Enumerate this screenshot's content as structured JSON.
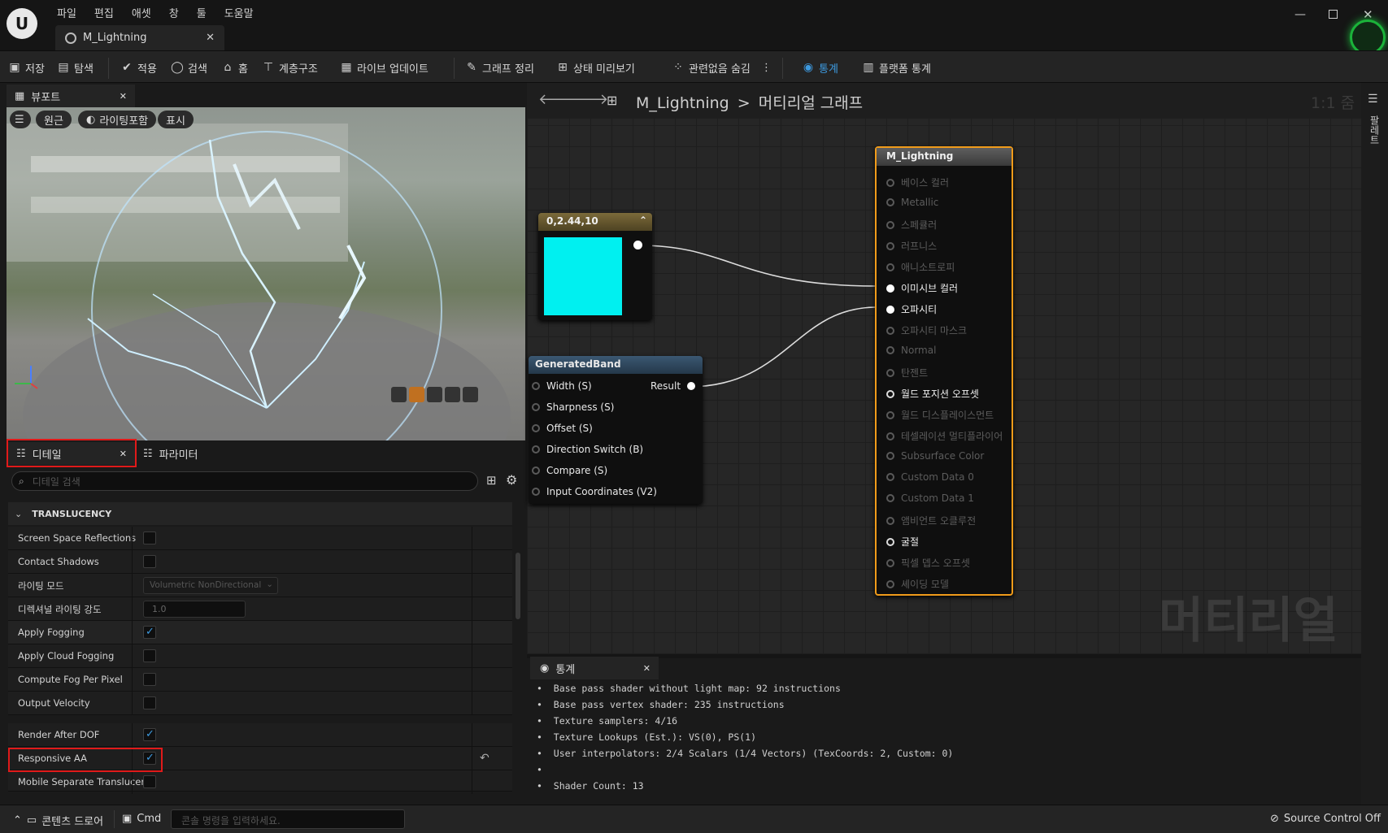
{
  "menu": [
    "파일",
    "편집",
    "애셋",
    "창",
    "툴",
    "도움말"
  ],
  "doc_tab": {
    "title": "M_Lightning"
  },
  "toolbar": {
    "save": "저장",
    "browse": "탐색",
    "apply": "적용",
    "search": "검색",
    "home": "홈",
    "hierarchy": "계층구조",
    "live_update": "라이브 업데이트",
    "clean_graph": "그래프 정리",
    "preview_state": "상태 미리보기",
    "hide_unrelated": "관련없음 숨김",
    "stats": "통계",
    "platform_stats": "플랫폼 통계"
  },
  "viewport": {
    "tab": "뷰포트",
    "perspective": "원근",
    "lit": "라이팅포함",
    "show": "표시"
  },
  "details": {
    "tab": "디테일",
    "params_tab": "파라미터",
    "search_placeholder": "디테일 검색",
    "section": "TRANSLUCENCY",
    "rows": [
      {
        "label": "Screen Space Reflections",
        "checked": false
      },
      {
        "label": "Contact Shadows",
        "checked": false
      },
      {
        "label": "라이팅 모드",
        "value": "Volumetric NonDirectional"
      },
      {
        "label": "디렉셔널 라이팅 강도",
        "value": "1.0"
      },
      {
        "label": "Apply Fogging",
        "checked": true
      },
      {
        "label": "Apply Cloud Fogging",
        "checked": false
      },
      {
        "label": "Compute Fog Per Pixel",
        "checked": false
      },
      {
        "label": "Output Velocity",
        "checked": false
      },
      {
        "label": "Render After DOF",
        "checked": true
      },
      {
        "label": "Responsive AA",
        "checked": true
      },
      {
        "label": "Mobile Separate Translucer",
        "checked": false
      }
    ]
  },
  "graph": {
    "breadcrumb_asset": "M_Lightning",
    "breadcrumb_sep": ">",
    "breadcrumb_graph": "머티리얼 그래프",
    "zoom": "1:1 줌",
    "watermark": "머티리얼",
    "const_node": {
      "title": "0,2.44,10",
      "color": "#00f0f0"
    },
    "band_node": {
      "title": "GeneratedBand",
      "output": "Result",
      "inputs": [
        "Width (S)",
        "Sharpness (S)",
        "Offset (S)",
        "Direction Switch (B)",
        "Compare (S)",
        "Input Coordinates (V2)"
      ]
    },
    "material_node": {
      "title": "M_Lightning",
      "pins": [
        {
          "label": "베이스 컬러",
          "state": "dim"
        },
        {
          "label": "Metallic",
          "state": "dim"
        },
        {
          "label": "스페큘러",
          "state": "dim"
        },
        {
          "label": "러프니스",
          "state": "dim"
        },
        {
          "label": "애니소트로피",
          "state": "dim"
        },
        {
          "label": "이미시브 컬러",
          "state": "act"
        },
        {
          "label": "오파시티",
          "state": "act"
        },
        {
          "label": "오파시티 마스크",
          "state": "dim"
        },
        {
          "label": "Normal",
          "state": "dim"
        },
        {
          "label": "탄젠트",
          "state": "dim"
        },
        {
          "label": "월드 포지션 오프셋",
          "state": "wht"
        },
        {
          "label": "월드 디스플레이스먼트",
          "state": "dim"
        },
        {
          "label": "테셀레이션 멀티플라이어",
          "state": "dim"
        },
        {
          "label": "Subsurface Color",
          "state": "dim"
        },
        {
          "label": "Custom Data 0",
          "state": "dim"
        },
        {
          "label": "Custom Data 1",
          "state": "dim"
        },
        {
          "label": "앰비언트 오클루전",
          "state": "dim"
        },
        {
          "label": "굴절",
          "state": "wht"
        },
        {
          "label": "픽셀 뎁스 오프셋",
          "state": "dim"
        },
        {
          "label": "셰이딩 모델",
          "state": "dim"
        }
      ]
    }
  },
  "stats_panel": {
    "tab": "통계",
    "lines": [
      "Base pass shader without light map: 92 instructions",
      "Base pass vertex shader: 235 instructions",
      "Texture samplers: 4/16",
      "Texture Lookups (Est.): VS(0), PS(1)",
      "User interpolators: 2/4 Scalars (1/4 Vectors) (TexCoords: 2, Custom: 0)",
      "",
      "Shader Count: 13"
    ]
  },
  "right_sidebar": {
    "label": "팔레트"
  },
  "statusbar": {
    "content_drawer": "콘텐츠 드로어",
    "cmd": "Cmd",
    "cmd_placeholder": "콘솔 명령을 입력하세요.",
    "source_control": "Source Control Off"
  }
}
